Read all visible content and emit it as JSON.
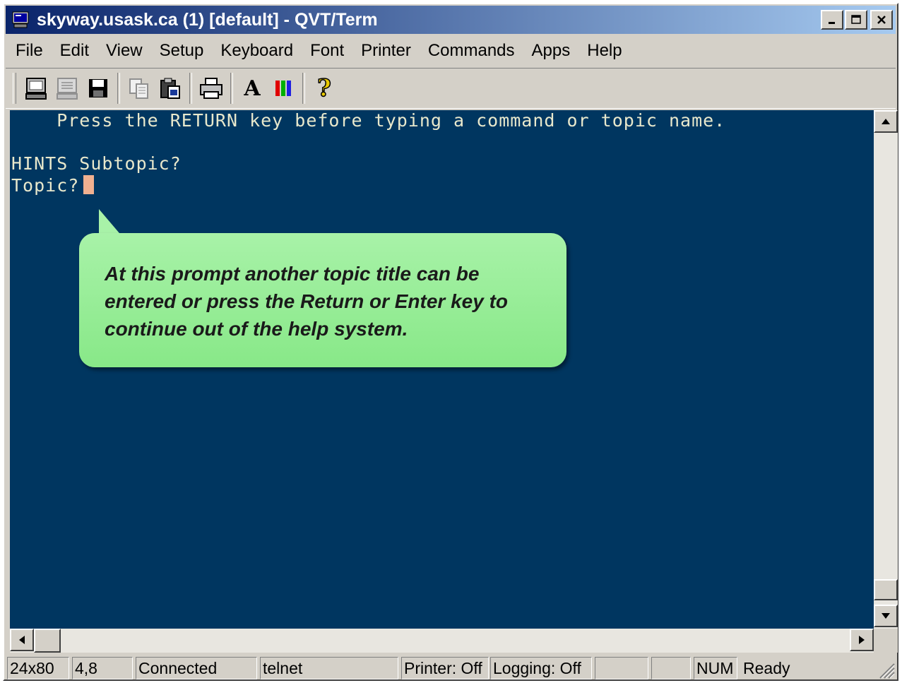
{
  "window": {
    "title": "skyway.usask.ca (1) [default] - QVT/Term"
  },
  "menu": [
    "File",
    "Edit",
    "View",
    "Setup",
    "Keyboard",
    "Font",
    "Printer",
    "Commands",
    "Apps",
    "Help"
  ],
  "toolbar": {
    "icons": [
      "connect-icon",
      "disconnect-icon",
      "save-icon",
      "copy-icon",
      "paste-icon",
      "print-icon",
      "font-icon",
      "colors-icon",
      "help-icon"
    ],
    "font_glyph": "A",
    "help_glyph": "?"
  },
  "terminal": {
    "lines": [
      "    Press the RETURN key before typing a command or topic name.",
      "",
      "HINTS Subtopic?",
      "Topic?"
    ],
    "colors": {
      "background": "#003660",
      "text": "#e8e8cc",
      "cursor": "#f0b090"
    }
  },
  "callout": {
    "text": "At this prompt another topic title can be entered or press the Return or Enter key to continue out of the help system."
  },
  "status": {
    "size": "24x80",
    "position": "4,8",
    "connection": "Connected",
    "protocol": "telnet",
    "printer": "Printer: Off",
    "logging": "Logging: Off",
    "empty1": "",
    "empty2": "",
    "num": "NUM",
    "ready": "Ready"
  }
}
